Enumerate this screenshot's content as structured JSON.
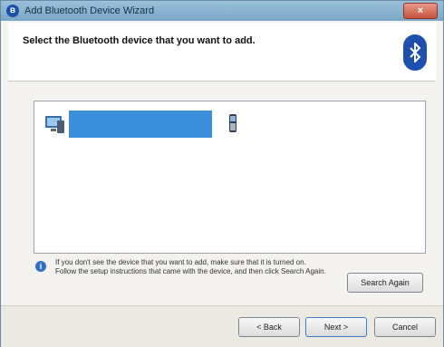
{
  "window": {
    "title": "Add Bluetooth Device Wizard",
    "close_glyph": "×"
  },
  "header": {
    "instruction": "Select the Bluetooth device that you want to add."
  },
  "devices": [
    {
      "name": "",
      "type": "",
      "selected": true,
      "icon": "computer-icon"
    },
    {
      "name": "",
      "type": "",
      "selected": false,
      "icon": "phone-icon"
    }
  ],
  "info": {
    "text": "If you don't see the device that you want to add, make sure that it is turned on. Follow the setup instructions that came with the device, and then click Search Again."
  },
  "buttons": {
    "search_again": "Search Again",
    "back": "< Back",
    "next": "Next >",
    "cancel": "Cancel"
  }
}
